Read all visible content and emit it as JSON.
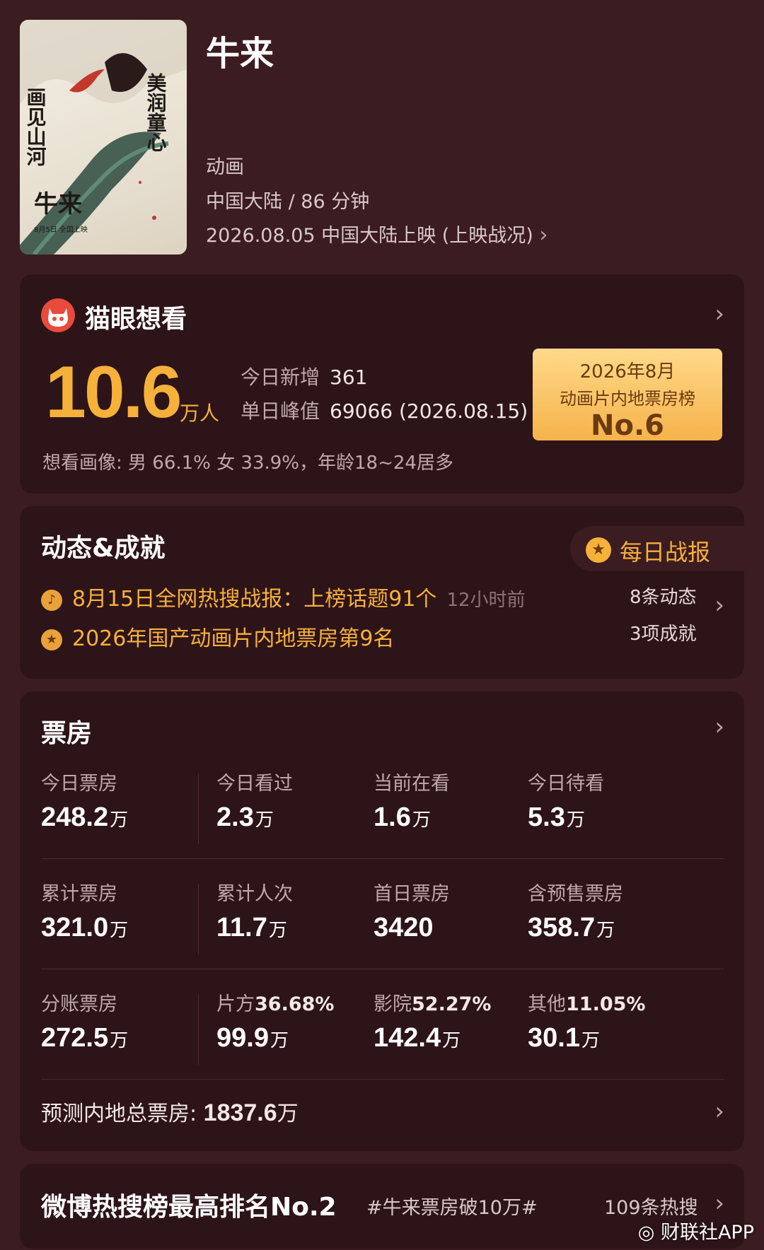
{
  "movie": {
    "title": "牛来",
    "genre": "动画",
    "region_duration": "中国大陆 / 86 分钟",
    "release": "2026.08.05 中国大陆上映 (上映战况)",
    "poster_text": {
      "left": "画见山河",
      "right": "美润童心",
      "name": "牛来",
      "date": "8月5日 全国上映"
    }
  },
  "maoyan": {
    "title": "猫眼想看",
    "big_number": "10.6",
    "big_unit": "万人",
    "today_new_label": "今日新增",
    "today_new_value": "361",
    "peak_label": "单日峰值",
    "peak_value": "69066 (2026.08.15)",
    "rank_line1": "2026年8月",
    "rank_line2": "动画片内地票房榜",
    "rank_line3": "No.6",
    "portrait": "想看画像: 男 66.1%  女 33.9%，年龄18~24居多"
  },
  "dynamics": {
    "title": "动态&成就",
    "daily_report": "每日战报",
    "news1": "8月15日全网热搜战报：上榜话题91个",
    "news1_time": "12小时前",
    "news2": "2026年国产动画片内地票房第9名",
    "count1": "8条动态",
    "count2": "3项成就"
  },
  "boxoffice": {
    "title": "票房",
    "rows": [
      [
        {
          "label": "今日票房",
          "value": "248.2",
          "unit": "万"
        },
        {
          "label": "今日看过",
          "value": "2.3",
          "unit": "万"
        },
        {
          "label": "当前在看",
          "value": "1.6",
          "unit": "万"
        },
        {
          "label": "今日待看",
          "value": "5.3",
          "unit": "万"
        }
      ],
      [
        {
          "label": "累计票房",
          "value": "321.0",
          "unit": "万"
        },
        {
          "label": "累计人次",
          "value": "11.7",
          "unit": "万"
        },
        {
          "label": "首日票房",
          "value": "3420",
          "unit": ""
        },
        {
          "label": "含预售票房",
          "value": "358.7",
          "unit": "万"
        }
      ],
      [
        {
          "label": "分账票房",
          "value": "272.5",
          "unit": "万"
        },
        {
          "label": "片方",
          "pct": "36.68%",
          "value": "99.9",
          "unit": "万"
        },
        {
          "label": "影院",
          "pct": "52.27%",
          "value": "142.4",
          "unit": "万"
        },
        {
          "label": "其他",
          "pct": "11.05%",
          "value": "30.1",
          "unit": "万"
        }
      ]
    ],
    "forecast_label": "预测内地总票房:",
    "forecast_value": "1837.6",
    "forecast_unit": "万"
  },
  "weibo": {
    "title": "微博热搜榜最高排名No.2",
    "tag": "#牛来票房破10万#",
    "count": "109条热搜"
  },
  "watermark": "财联社APP",
  "icons": {
    "chevron": "chevron-right-icon",
    "cat": "maoyan-cat-icon",
    "medal": "medal-icon",
    "bell": "bell-icon",
    "weibo": "weibo-icon"
  },
  "colors": {
    "background": "#3b1c21",
    "card": "#2d1418",
    "accent": "#f6b13a"
  }
}
